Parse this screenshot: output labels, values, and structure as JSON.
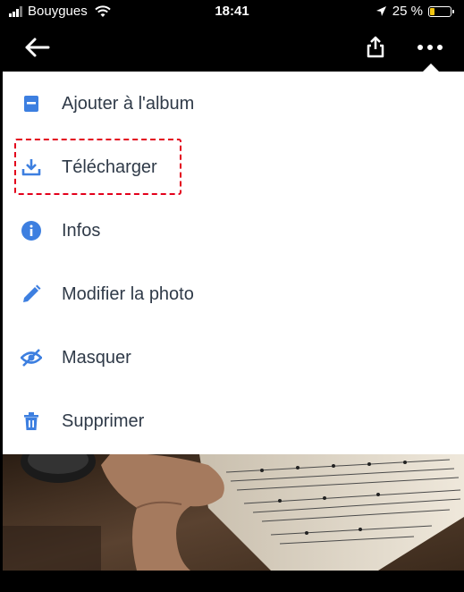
{
  "status_bar": {
    "carrier": "Bouygues",
    "time": "18:41",
    "battery_percent": "25 %",
    "battery_level": 0.25
  },
  "app_bar": {
    "back_icon": "arrow-left-icon",
    "share_icon": "share-icon",
    "more_icon": "more-horizontal-icon"
  },
  "menu": {
    "items": [
      {
        "label": "Ajouter à l'album",
        "icon": "album-icon"
      },
      {
        "label": "Télécharger",
        "icon": "download-icon"
      },
      {
        "label": "Infos",
        "icon": "info-icon"
      },
      {
        "label": "Modifier la photo",
        "icon": "edit-icon"
      },
      {
        "label": "Masquer",
        "icon": "hide-icon"
      },
      {
        "label": "Supprimer",
        "icon": "delete-icon"
      }
    ]
  },
  "colors": {
    "icon_blue": "#3d7fe0",
    "highlight_red": "#e3001b",
    "label_text": "#2f3a48"
  }
}
